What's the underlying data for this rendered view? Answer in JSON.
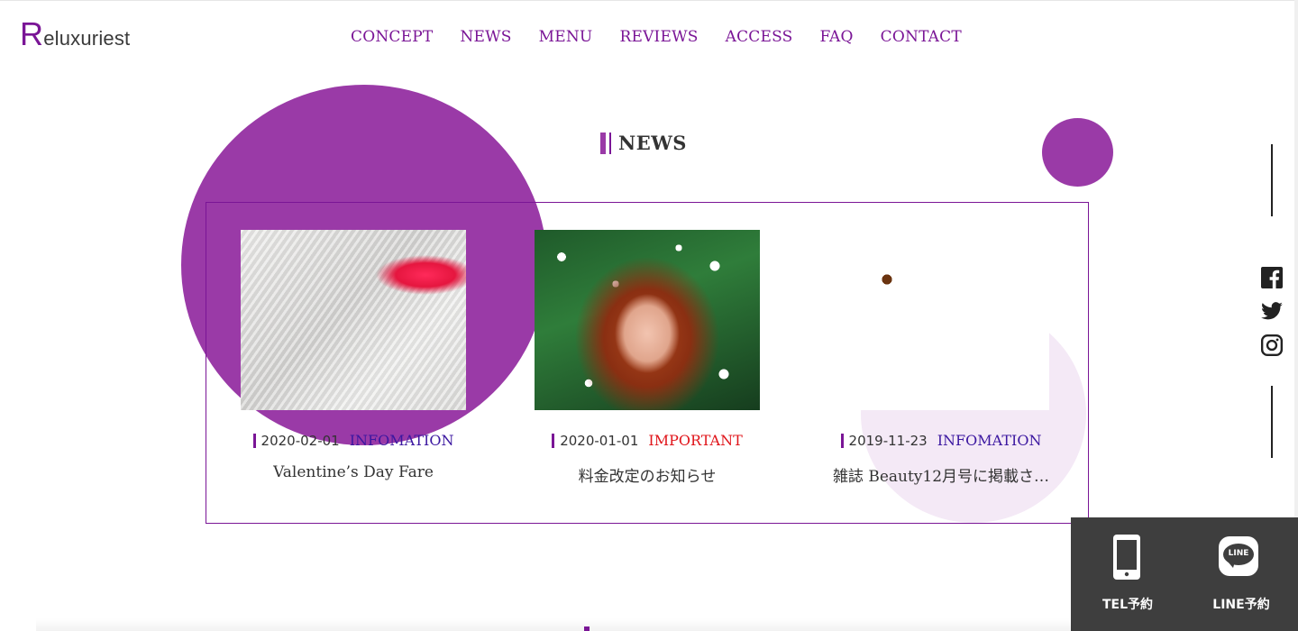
{
  "header": {
    "logo_initial": "R",
    "logo_rest": "eluxuriest",
    "nav": [
      "CONCEPT",
      "NEWS",
      "MENU",
      "REVIEWS",
      "ACCESS",
      "FAQ",
      "CONTACT"
    ]
  },
  "section": {
    "title": "NEWS"
  },
  "news": [
    {
      "date": "2020-02-01",
      "category": "INFOMATION",
      "category_type": "info",
      "title": "Valentine’s Day Fare",
      "image": "blond-hair-red-lips-photo"
    },
    {
      "date": "2020-01-01",
      "category": "IMPORTANT",
      "category_type": "important",
      "title": "料金改定のお知らせ",
      "image": "redhead-among-white-flowers-photo"
    },
    {
      "date": "2019-11-23",
      "category": "INFOMATION",
      "category_type": "info",
      "title": "雑誌 Beauty12月号に掲載さ…",
      "image": "colorful-painted-face-photo"
    }
  ],
  "social": [
    "facebook-icon",
    "twitter-icon",
    "instagram-icon"
  ],
  "booking": {
    "tel_label": "TEL予約",
    "line_label": "LINE予約",
    "line_icon_text": "LINE"
  },
  "colors": {
    "brand": "#7a1596",
    "accent_circle": "#9a3aa7",
    "pale_circle": "#f4e9f6",
    "info": "#3b17a0",
    "important": "#e0141a",
    "panel": "#3e3e3e"
  }
}
